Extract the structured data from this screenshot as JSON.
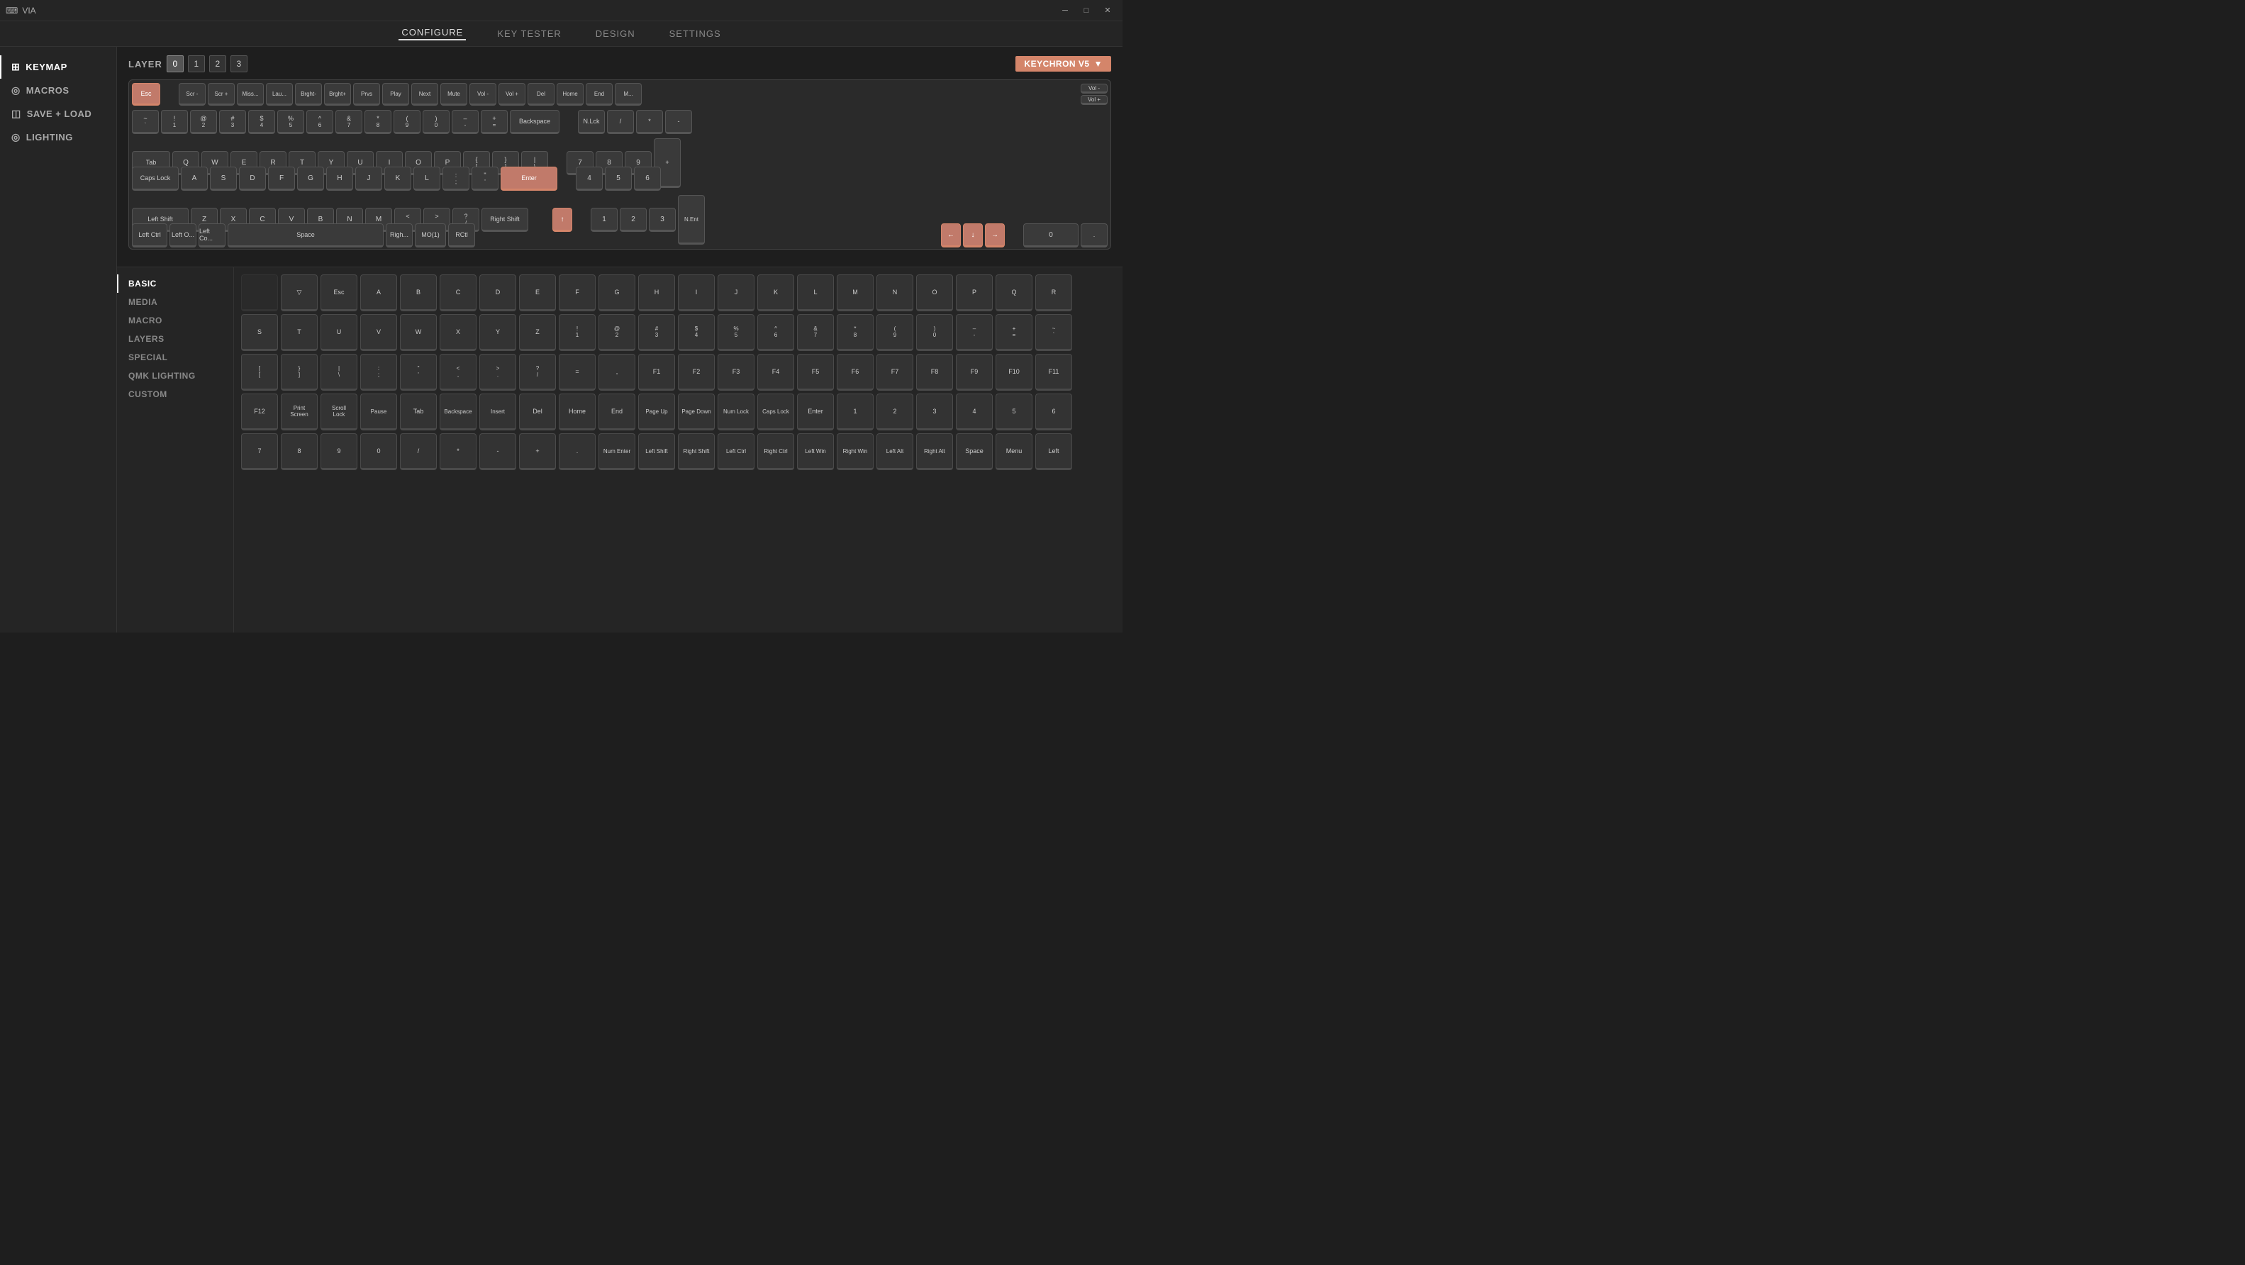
{
  "app": {
    "title": "VIA",
    "titlebar": {
      "minimize": "─",
      "maximize": "□",
      "close": "✕"
    }
  },
  "nav": {
    "items": [
      {
        "label": "CONFIGURE",
        "active": true
      },
      {
        "label": "KEY TESTER",
        "active": false
      },
      {
        "label": "DESIGN",
        "active": false
      },
      {
        "label": "SETTINGS",
        "active": false
      }
    ]
  },
  "sidebar": {
    "items": [
      {
        "label": "KEYMAP",
        "icon": "⊞",
        "active": true
      },
      {
        "label": "MACROS",
        "icon": "◎",
        "active": false
      },
      {
        "label": "SAVE + LOAD",
        "icon": "◫",
        "active": false
      },
      {
        "label": "LIGHTING",
        "icon": "◎",
        "active": false
      }
    ]
  },
  "keyboard": {
    "layer_label": "LAYER",
    "layers": [
      "0",
      "1",
      "2",
      "3"
    ],
    "active_layer": 0,
    "device": "KEYCHRON V5",
    "rows": {
      "row0": [
        {
          "label": "Esc",
          "highlight": true
        },
        {
          "label": "Scr -"
        },
        {
          "label": "Scr +"
        },
        {
          "label": "Miss..."
        },
        {
          "label": "Lau..."
        },
        {
          "label": "Brght-"
        },
        {
          "label": "Brght+"
        },
        {
          "label": "Prvs"
        },
        {
          "label": "Play"
        },
        {
          "label": "Next"
        },
        {
          "label": "Mute"
        },
        {
          "label": "Vol -"
        },
        {
          "label": "Vol +"
        },
        {
          "label": "Del"
        },
        {
          "label": "Home"
        },
        {
          "label": "End"
        },
        {
          "label": "M..."
        },
        {
          "label": "Vol -"
        },
        {
          "label": "Vol +"
        }
      ]
    }
  },
  "keymap_sections": [
    {
      "label": "BASIC",
      "active": true
    },
    {
      "label": "MEDIA"
    },
    {
      "label": "MACRO"
    },
    {
      "label": "LAYERS"
    },
    {
      "label": "SPECIAL"
    },
    {
      "label": "QMK LIGHTING"
    },
    {
      "label": "CUSTOM"
    }
  ],
  "grid_rows": [
    [
      "",
      "▽",
      "Esc",
      "A",
      "B",
      "C",
      "D",
      "E",
      "F",
      "G",
      "H",
      "I",
      "J",
      "K",
      "L",
      "M",
      "N",
      "O",
      "P",
      "Q",
      "R"
    ],
    [
      "S",
      "T",
      "U",
      "V",
      "W",
      "X",
      "Y",
      "Z",
      "!\n1",
      "@\n2",
      "#\n3",
      "$\n4",
      "%\n5",
      "^\n6",
      "&\n7",
      "*\n8",
      "(\n9",
      ")\n0",
      "–\n-",
      "+\n=",
      "~\n`"
    ],
    [
      "[\n[",
      "}\n]",
      "|\n\\",
      ":\n;",
      "\"\n'",
      "<\n,",
      ">\n.",
      "?\n/",
      "=",
      ",",
      "F1",
      "F2",
      "F3",
      "F4",
      "F5",
      "F6",
      "F7",
      "F8",
      "F9",
      "F10",
      "F11"
    ],
    [
      "F12",
      "Print\nScreen",
      "Scroll\nLock",
      "Pause",
      "Tab",
      "Backspace",
      "Insert",
      "Del",
      "Home",
      "End",
      "Page\nUp",
      "Page\nDown",
      "Num\nLock",
      "Caps\nLock",
      "Enter",
      "1",
      "2",
      "3",
      "4",
      "5",
      "6"
    ],
    [
      "7",
      "8",
      "9",
      "0",
      "/",
      "*",
      "-",
      "+",
      ".",
      "Num\nEnter",
      "Left\nShift",
      "Right\nShift",
      "Left Ctrl",
      "Right\nCtrl",
      "Left Win",
      "Right\nWin",
      "Left Alt",
      "Right Alt",
      "Space",
      "Menu",
      "Left"
    ]
  ]
}
